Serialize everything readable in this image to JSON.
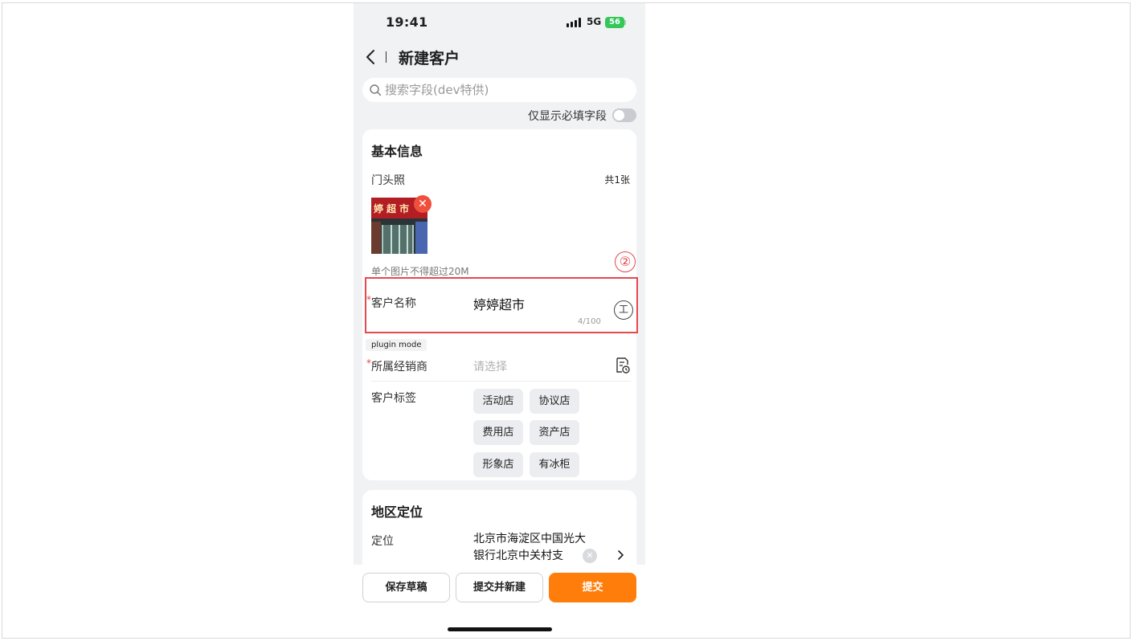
{
  "status_bar": {
    "time": "19:41",
    "network": "5G",
    "battery": "56"
  },
  "nav": {
    "title": "新建客户"
  },
  "search": {
    "placeholder": "搜索字段(dev特供)"
  },
  "filter": {
    "required_only_label": "仅显示必填字段",
    "required_only_on": false
  },
  "basic_info": {
    "section_title": "基本信息",
    "storefront_photo": {
      "label": "门头照",
      "count_text": "共1张",
      "photo_sign_text": "婷超市",
      "hint": "单个图片不得超过20M"
    },
    "step_marker": "②",
    "customer_name": {
      "label": "客户名称",
      "value": "婷婷超市",
      "char_count": "4/100",
      "ocr_icon_glyph": "工"
    },
    "plugin_badge": "plugin mode",
    "dealer": {
      "label": "所属经销商",
      "placeholder": "请选择"
    },
    "customer_tags": {
      "label": "客户标签",
      "tags": [
        "活动店",
        "协议店",
        "费用店",
        "资产店",
        "形象店",
        "有冰柜"
      ]
    }
  },
  "region": {
    "section_title": "地区定位",
    "location": {
      "label": "定位",
      "value": "北京市海淀区中国光大银行北京中关村支"
    }
  },
  "actions": {
    "save_draft": "保存草稿",
    "submit_and_new": "提交并新建",
    "submit": "提交"
  },
  "colors": {
    "primary": "#ff7d0a",
    "highlight": "#e5484d",
    "required": "#e5484d"
  }
}
